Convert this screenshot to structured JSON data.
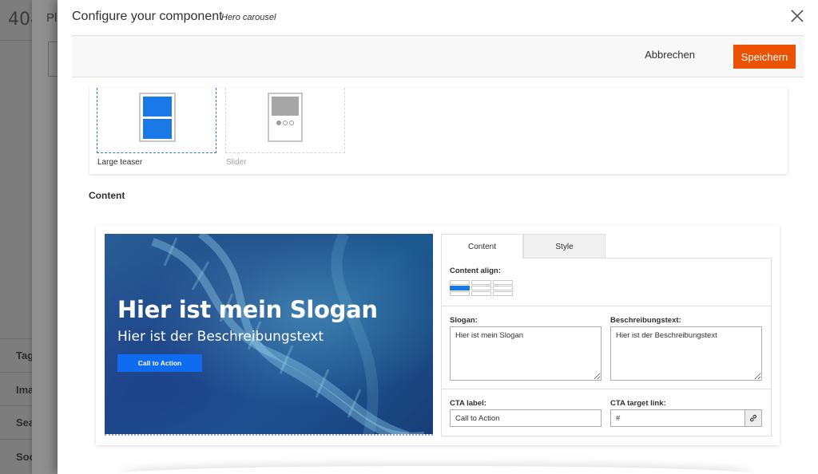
{
  "background_page": {
    "title_fragment": "404",
    "subtitle_fragment": "Pl",
    "left_items": [
      "Tag",
      "Ima",
      "Sea",
      "Soc"
    ]
  },
  "modal": {
    "title": "Configure your component",
    "subtitle": "Hero carousel",
    "close_icon": "close-icon",
    "actions": {
      "cancel_label": "Abbrechen",
      "save_label": "Speichern",
      "save_color": "#eb5202"
    }
  },
  "templates": {
    "options": [
      {
        "label": "Large teaser",
        "selected": true
      },
      {
        "label": "Slider",
        "selected": false
      }
    ],
    "accent": "#1979e6"
  },
  "content": {
    "heading": "Content",
    "preview": {
      "slogan": "Hier ist mein Slogan",
      "description": "Hier ist der Beschreibungstext",
      "cta": "Call to Action"
    },
    "tabs": [
      {
        "label": "Content",
        "active": true
      },
      {
        "label": "Style",
        "active": false
      }
    ],
    "content_align_label": "Content align:",
    "content_align_selected": "middle-left",
    "slogan_label": "Slogan:",
    "slogan_value": "Hier ist mein Slogan",
    "desc_label": "Beschreibungstext:",
    "desc_value": "Hier ist der Beschreibungstext",
    "cta_label_label": "CTA label:",
    "cta_label_value": "Call to Action",
    "cta_link_label": "CTA target link:",
    "cta_link_value": "#",
    "link_icon": "link-icon"
  }
}
